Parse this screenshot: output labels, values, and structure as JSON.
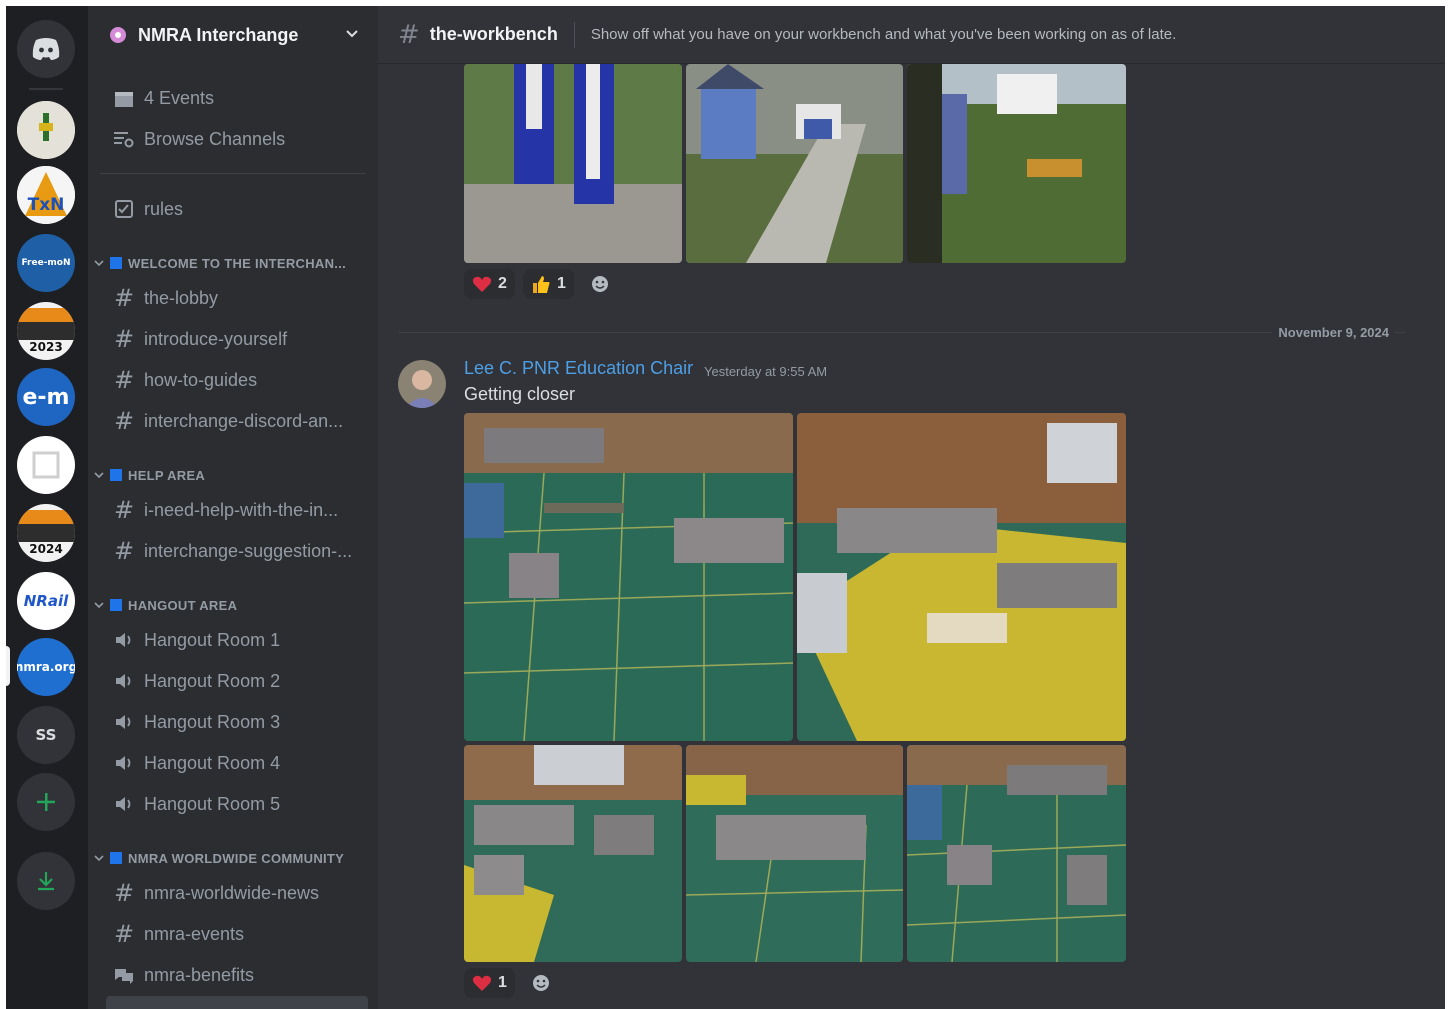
{
  "guild": {
    "name": "NMRA Interchange"
  },
  "servers": [
    {
      "name": "server-p",
      "label": ""
    },
    {
      "name": "server-txn",
      "label": "TxN"
    },
    {
      "name": "server-free-mon",
      "label": "Free-moN"
    },
    {
      "name": "server-2023",
      "label": "2023"
    },
    {
      "name": "server-e-m",
      "label": "e-m"
    },
    {
      "name": "server-e",
      "label": ""
    },
    {
      "name": "server-2024",
      "label": "2024"
    },
    {
      "name": "server-nrail",
      "label": "NRail"
    },
    {
      "name": "server-nmra-org",
      "label": "nmra.org"
    },
    {
      "name": "server-ss",
      "label": "SS"
    }
  ],
  "sidebar": {
    "events": "4 Events",
    "browse": "Browse Channels",
    "rules": "rules",
    "categories": [
      {
        "label": "WELCOME TO THE INTERCHAN...",
        "channels": [
          "the-lobby",
          "introduce-yourself",
          "how-to-guides",
          "interchange-discord-an..."
        ]
      },
      {
        "label": "HELP AREA",
        "channels": [
          "i-need-help-with-the-in...",
          "interchange-suggestion-..."
        ]
      },
      {
        "label": "HANGOUT AREA",
        "channels": [
          "Hangout Room 1",
          "Hangout Room 2",
          "Hangout Room 3",
          "Hangout Room 4",
          "Hangout Room 5"
        ]
      },
      {
        "label": "NMRA WORLDWIDE COMMUNITY",
        "channels": [
          "nmra-worldwide-news",
          "nmra-events",
          "nmra-benefits"
        ]
      }
    ]
  },
  "channel": {
    "name": "the-workbench",
    "topic": "Show off what you have on your workbench and what you've been working on as of late."
  },
  "first_message": {
    "reactions": [
      {
        "emoji": "heart",
        "count": "2"
      },
      {
        "emoji": "thumbs-up",
        "count": "1"
      }
    ]
  },
  "date_divider": "November 9, 2024",
  "message": {
    "author": "Lee C. PNR Education Chair",
    "timestamp": "Yesterday at 9:55 AM",
    "text": "Getting closer",
    "reactions": [
      {
        "emoji": "heart",
        "count": "1"
      }
    ]
  },
  "colors": {
    "background": "#313338",
    "sidebar": "#2b2d31",
    "rail": "#1e1f22",
    "author": "#4d9fe6",
    "category_square": "#1e74e8",
    "add_server": "#23a55a"
  }
}
